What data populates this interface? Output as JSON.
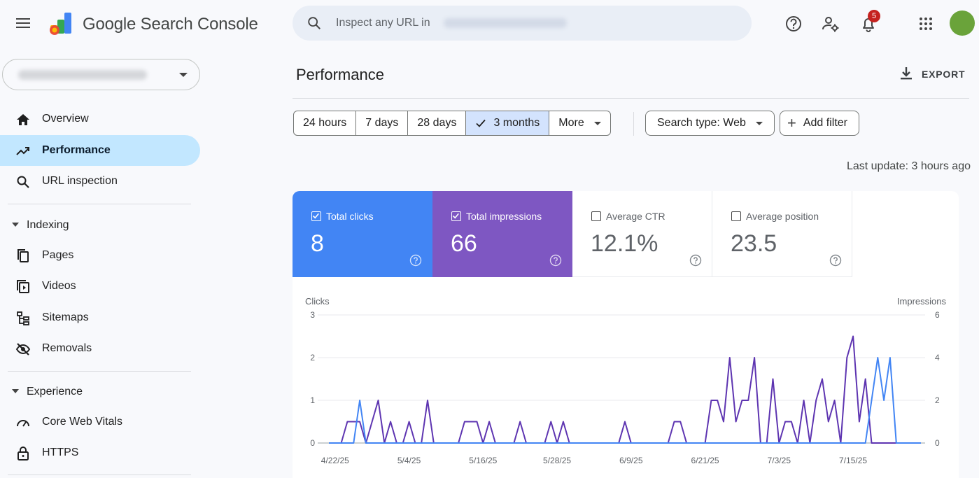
{
  "app": {
    "product_name": "Google Search Console",
    "search_placeholder": "Inspect any URL in",
    "notification_count": "5"
  },
  "sidebar": {
    "items": [
      {
        "label": "Overview",
        "icon": "home-icon"
      },
      {
        "label": "Performance",
        "icon": "trending-up-icon",
        "active": true
      },
      {
        "label": "URL inspection",
        "icon": "search-icon"
      }
    ],
    "sections": [
      {
        "label": "Indexing",
        "items": [
          {
            "label": "Pages",
            "icon": "pages-icon"
          },
          {
            "label": "Videos",
            "icon": "video-icon"
          },
          {
            "label": "Sitemaps",
            "icon": "sitemap-icon"
          },
          {
            "label": "Removals",
            "icon": "removals-icon"
          }
        ]
      },
      {
        "label": "Experience",
        "items": [
          {
            "label": "Core Web Vitals",
            "icon": "gauge-icon"
          },
          {
            "label": "HTTPS",
            "icon": "lock-icon"
          }
        ]
      }
    ]
  },
  "main": {
    "title": "Performance",
    "export_label": "EXPORT",
    "date_ranges": [
      "24 hours",
      "7 days",
      "28 days",
      "3 months",
      "More"
    ],
    "selected_range": "3 months",
    "search_type_label": "Search type: Web",
    "add_filter_label": "Add filter",
    "last_update": "Last update: 3 hours ago"
  },
  "metrics": [
    {
      "label": "Total clicks",
      "value": "8",
      "checked": true,
      "color": "#4285f4"
    },
    {
      "label": "Total impressions",
      "value": "66",
      "checked": true,
      "color": "#7e57c2"
    },
    {
      "label": "Average CTR",
      "value": "12.1%",
      "checked": false
    },
    {
      "label": "Average position",
      "value": "23.5",
      "checked": false
    }
  ],
  "colors": {
    "clicks": "#4285f4",
    "impressions": "#5e35b1",
    "active_nav": "#c2e7ff",
    "selected_range": "#d3e3fd"
  },
  "chart_data": {
    "type": "line",
    "left_axis_label": "Clicks",
    "right_axis_label": "Impressions",
    "left_ylim": [
      0,
      3
    ],
    "right_ylim": [
      0,
      6
    ],
    "left_ticks": [
      "0",
      "1",
      "2",
      "3"
    ],
    "right_ticks": [
      "0",
      "2",
      "4",
      "6"
    ],
    "x_tick_labels": [
      "4/22/25",
      "5/4/25",
      "5/16/25",
      "5/28/25",
      "6/9/25",
      "6/21/25",
      "7/3/25",
      "7/15/25"
    ],
    "series": [
      {
        "name": "Clicks",
        "axis": "left",
        "color": "#4285f4",
        "values": [
          0,
          0,
          0,
          0,
          0,
          1,
          0,
          0,
          0,
          0,
          0,
          0,
          0,
          0,
          0,
          0,
          0,
          0,
          0,
          0,
          0,
          0,
          0,
          0,
          0,
          0,
          0,
          0,
          0,
          0,
          0,
          0,
          0,
          0,
          0,
          0,
          0,
          0,
          0,
          0,
          0,
          0,
          0,
          0,
          0,
          0,
          0,
          0,
          0,
          0,
          0,
          0,
          0,
          0,
          0,
          0,
          0,
          0,
          0,
          0,
          0,
          0,
          0,
          0,
          0,
          0,
          0,
          0,
          0,
          0,
          0,
          0,
          0,
          0,
          0,
          0,
          0,
          0,
          0,
          0,
          0,
          0,
          0,
          0,
          0,
          0,
          0,
          0,
          1,
          2,
          1,
          2,
          0,
          0,
          0,
          0,
          0
        ]
      },
      {
        "name": "Impressions",
        "axis": "right",
        "color": "#5e35b1",
        "values": [
          0,
          0,
          0,
          1,
          1,
          1,
          0,
          1,
          2,
          0,
          1,
          0,
          0,
          1,
          0,
          0,
          2,
          0,
          0,
          0,
          0,
          0,
          1,
          1,
          1,
          0,
          1,
          0,
          0,
          0,
          0,
          1,
          0,
          0,
          0,
          0,
          1,
          0,
          1,
          0,
          0,
          0,
          0,
          0,
          0,
          0,
          0,
          0,
          1,
          0,
          0,
          0,
          0,
          0,
          0,
          0,
          1,
          1,
          0,
          0,
          0,
          0,
          2,
          2,
          1,
          4,
          1,
          2,
          2,
          4,
          0,
          0,
          3,
          0,
          1,
          1,
          0,
          2,
          0,
          2,
          3,
          1,
          2,
          0,
          4,
          5,
          1,
          3,
          0,
          0,
          0,
          0,
          0
        ]
      }
    ]
  }
}
